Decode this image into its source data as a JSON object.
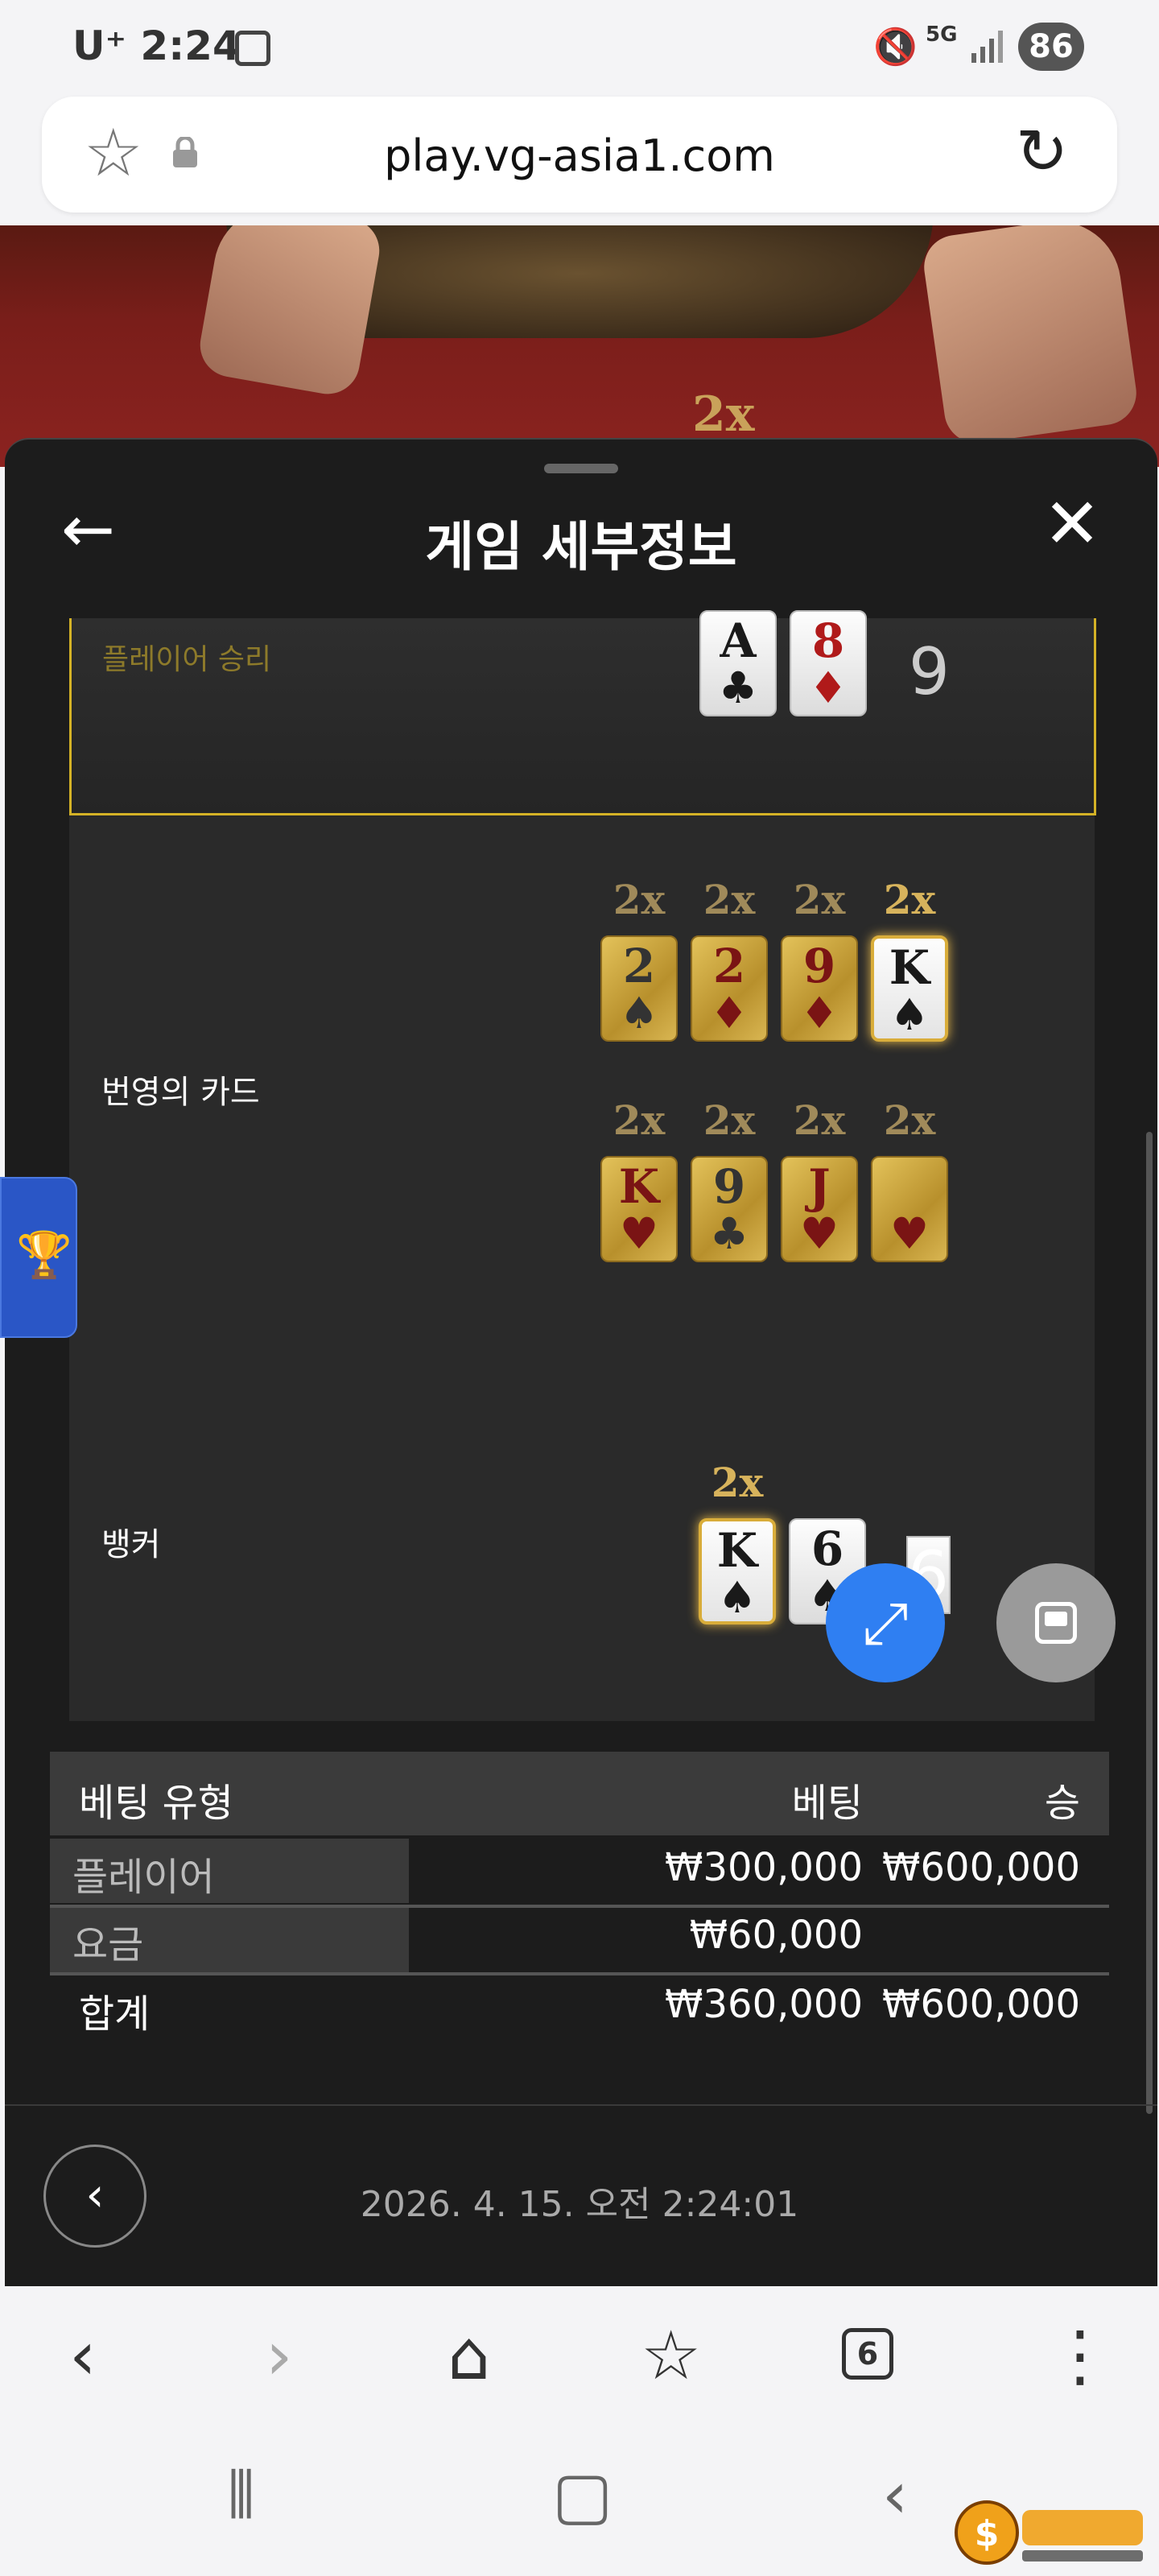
{
  "status_bar": {
    "carrier": "U⁺ 2:24",
    "network": "5G",
    "battery": "86"
  },
  "browser": {
    "url": "play.vg-asia1.com"
  },
  "background": {
    "multiplier": "2x"
  },
  "panel": {
    "title": "게임 세부정보",
    "win_label": "플레이어 승리",
    "player_cards": [
      {
        "rank": "A",
        "suit": "♣",
        "color": "black"
      },
      {
        "rank": "8",
        "suit": "♦",
        "color": "red"
      }
    ],
    "player_score": "9",
    "lucky_label": "번영의 카드",
    "lucky_row1": [
      {
        "mult": "2x",
        "rank": "2",
        "suit": "♠",
        "color": "black"
      },
      {
        "mult": "2x",
        "rank": "2",
        "suit": "♦",
        "color": "red"
      },
      {
        "mult": "2x",
        "rank": "9",
        "suit": "♦",
        "color": "red"
      },
      {
        "mult": "2x",
        "rank": "K",
        "suit": "♠",
        "color": "black"
      }
    ],
    "lucky_row2": [
      {
        "mult": "2x",
        "rank": "K",
        "suit": "♥",
        "color": "red"
      },
      {
        "mult": "2x",
        "rank": "9",
        "suit": "♣",
        "color": "black"
      },
      {
        "mult": "2x",
        "rank": "J",
        "suit": "♥",
        "color": "red"
      },
      {
        "mult": "2x",
        "rank": "",
        "suit": "♥",
        "color": "red"
      }
    ],
    "banker_label": "뱅커",
    "banker_mult": "2x",
    "banker_cards": [
      {
        "rank": "K",
        "suit": "♠",
        "color": "black"
      },
      {
        "rank": "6",
        "suit": "♠",
        "color": "black"
      }
    ],
    "banker_score": "6"
  },
  "bet_table": {
    "headers": {
      "type": "베팅 유형",
      "bet": "베팅",
      "win": "승"
    },
    "rows": [
      {
        "type": "플레이어",
        "bet": "₩300,000",
        "win": "₩600,000"
      },
      {
        "type": "요금",
        "bet": "₩60,000",
        "win": ""
      }
    ],
    "total": {
      "type": "합계",
      "bet": "₩360,000",
      "win": "₩600,000"
    }
  },
  "footer": {
    "timestamp": "2026. 4. 15. 오전 2:24:01"
  },
  "bottom_nav": {
    "tab_count": "6"
  },
  "colors": {
    "accent": "#2f7ff2",
    "gold": "#d4b226",
    "panel_bg": "#1c1c1c"
  }
}
